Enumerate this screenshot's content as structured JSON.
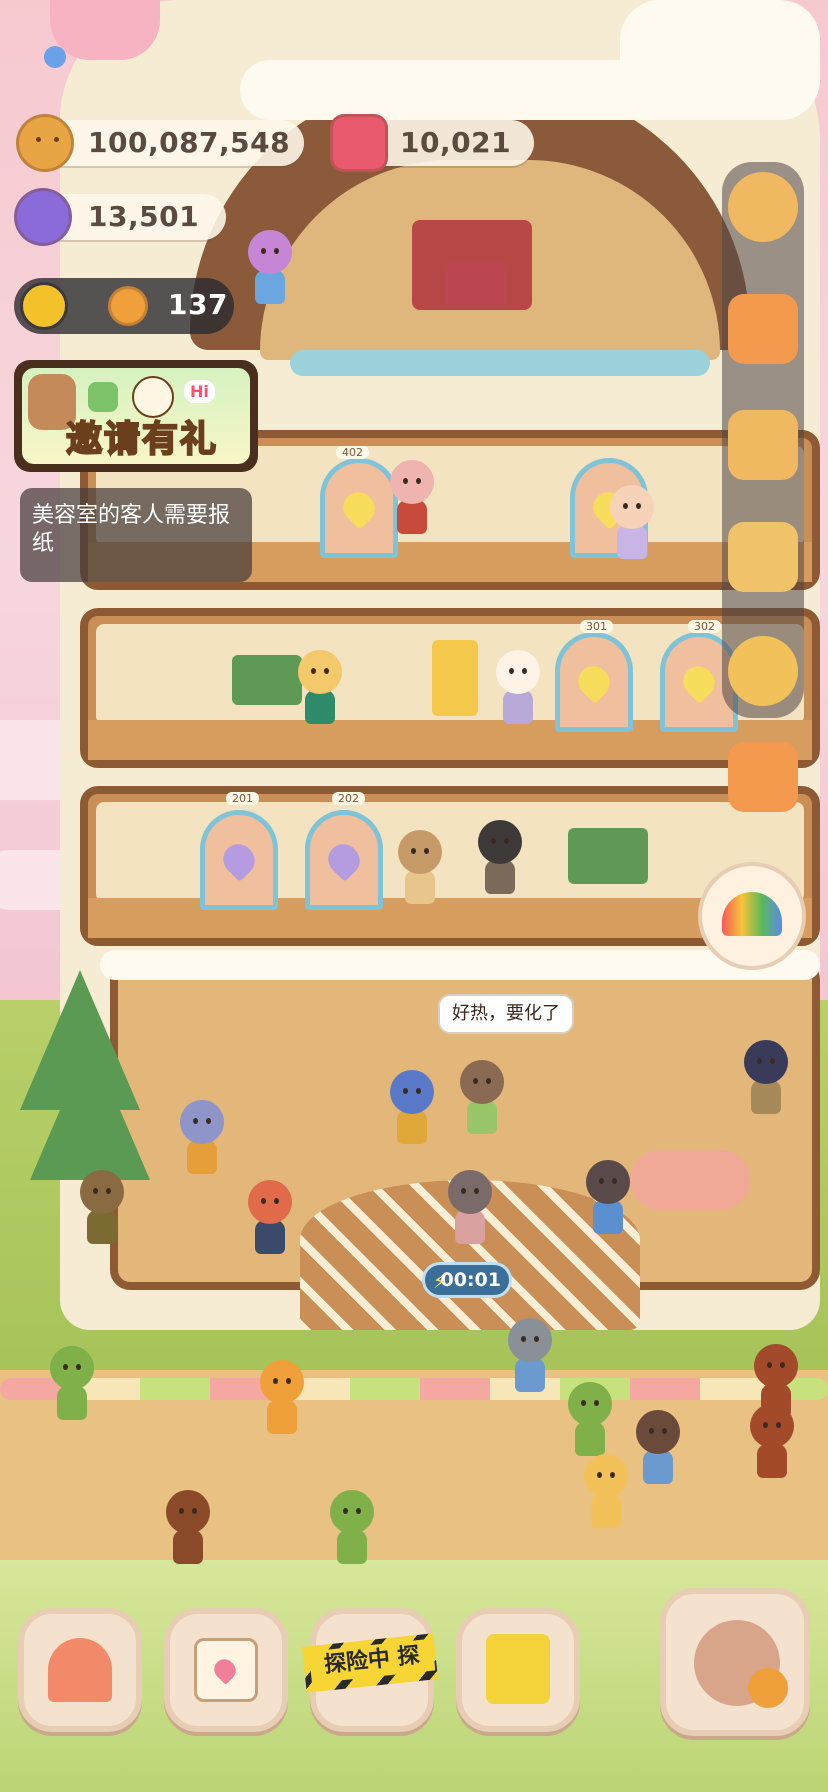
{
  "hud": {
    "coins": "100,087,548",
    "candy": "10,021",
    "gems": "13,501",
    "tokens": "137"
  },
  "invite": {
    "label": "邀请有礼",
    "badge": "Hi"
  },
  "tip": {
    "text": "美容室的客人需要报纸"
  },
  "rooms": {
    "room_402": "402",
    "room_301": "301",
    "room_302": "302",
    "room_201": "201",
    "room_202": "202"
  },
  "speech": {
    "text": "好热，要化了"
  },
  "timer": {
    "text": "00:01"
  },
  "nav": {
    "explore_label": "探险中 探"
  },
  "sidebar": [
    "gear-icon",
    "ticket-icon",
    "medal-icon",
    "bag-icon",
    "friends-icon",
    "camera-icon"
  ],
  "colors": {
    "accent_brown": "#8e5a33",
    "hud_text": "#5b4a3f",
    "icing": "#fffaf0"
  }
}
